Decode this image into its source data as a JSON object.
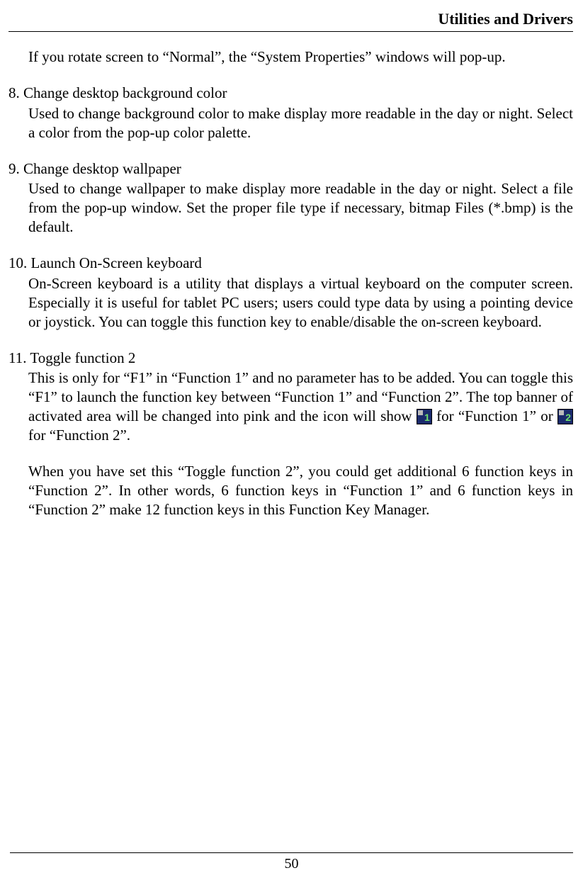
{
  "header": "Utilities and Drivers",
  "intro": "If you rotate screen to “Normal”, the “System Properties” windows will pop-up.",
  "item8": {
    "heading": "8. Change desktop background color",
    "body": "Used to change background color to make display more readable in the day or night. Select a color from the pop-up color palette."
  },
  "item9": {
    "heading": "9. Change desktop wallpaper",
    "body": "Used to change wallpaper to make display more readable in the day or night. Select a file from the pop-up window. Set the proper file type if necessary, bitmap Files (*.bmp) is the default."
  },
  "item10": {
    "heading": "10. Launch On-Screen keyboard",
    "body": "On-Screen keyboard is a utility that displays a virtual keyboard on the computer screen. Especially it is useful for tablet PC users; users could type data by using a pointing device or joystick. You can toggle this function key to enable/disable the on-screen keyboard."
  },
  "item11": {
    "heading": "11. Toggle function 2",
    "body_pre": "This is only for “F1” in “Function 1” and no parameter has to be added. You can toggle this “F1” to launch the function key between “Function 1” and “Function 2”. The top banner of activated area will be changed into pink and the icon will show ",
    "body_mid": " for “Function 1” or ",
    "body_post": " for “Function 2”.",
    "body2": "When you have set this “Toggle function 2”, you could get additional 6 function keys in “Function 2”. In other words, 6 function keys in “Function 1” and 6 function keys in “Function 2” make 12 function keys in this Function Key Manager."
  },
  "icons": {
    "f1": "1",
    "f2": "2"
  },
  "page_number": "50"
}
